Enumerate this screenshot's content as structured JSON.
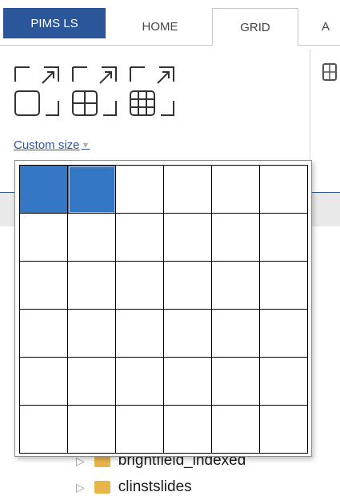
{
  "ribbon": {
    "tabs": [
      {
        "label": "PIMS LS",
        "active": false
      },
      {
        "label": "HOME",
        "active": false
      },
      {
        "label": "GRID",
        "active": true
      },
      {
        "label": "A",
        "active": false
      }
    ],
    "accent_color": "#2b579a"
  },
  "grid_group": {
    "buttons": [
      {
        "icon": "grid-1x1-icon"
      },
      {
        "icon": "grid-2x2-icon"
      },
      {
        "icon": "grid-3x3-icon"
      }
    ],
    "custom_size_label": "Custom size"
  },
  "grid_picker": {
    "rows": 6,
    "columns": 6,
    "selected_rows": 1,
    "selected_columns": 2,
    "selected_color": "#3477c4"
  },
  "tree": {
    "items": [
      {
        "label": "brightfield_indexed"
      },
      {
        "label": "clinstslides"
      }
    ]
  }
}
